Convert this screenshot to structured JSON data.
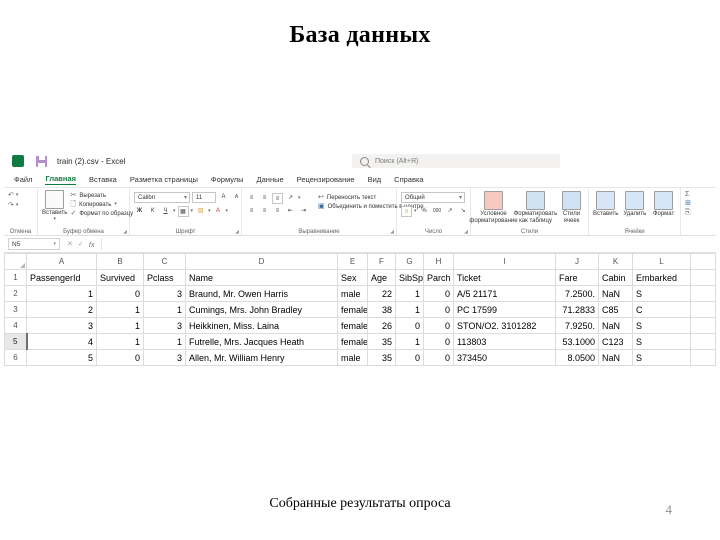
{
  "slide": {
    "title": "База данных",
    "caption": "Собранные результаты опроса",
    "number": "4"
  },
  "excel": {
    "title_bar": {
      "file_title": "train (2).csv  -  Excel",
      "excel_icon": "excel-app-icon",
      "save_icon": "save-icon",
      "search_icon": "search-icon",
      "search_placeholder": "Поиск (Alt+Я)"
    },
    "tabs": [
      {
        "label": "Файл",
        "active": false
      },
      {
        "label": "Главная",
        "active": true
      },
      {
        "label": "Вставка",
        "active": false
      },
      {
        "label": "Разметка страницы",
        "active": false
      },
      {
        "label": "Формулы",
        "active": false
      },
      {
        "label": "Данные",
        "active": false
      },
      {
        "label": "Рецензирование",
        "active": false
      },
      {
        "label": "Вид",
        "active": false
      },
      {
        "label": "Справка",
        "active": false
      }
    ],
    "ribbon": {
      "undo_group": {
        "label": "Отмена",
        "undo_icon": "undo-arrow-icon",
        "redo_icon": "redo-arrow-icon",
        "dropdown_icon": "chevron-down-icon"
      },
      "clipboard_group": {
        "label": "Буфер обмена",
        "paste_label": "Вставить",
        "paste_icon": "clipboard-icon",
        "cut_label": "Вырезать",
        "cut_icon": "scissors-icon",
        "copy_label": "Копировать",
        "copy_icon": "copy-icon",
        "format_painter_label": "Формат по образцу",
        "format_painter_icon": "paintbrush-icon",
        "dialog_icon": "dialog-launcher-icon"
      },
      "font_group": {
        "label": "Шрифт",
        "font_name": "Calibri",
        "font_size": "11",
        "bold_label": "Ж",
        "italic_label": "К",
        "underline_label": "Ч",
        "grow_label": "A",
        "shrink_label": "A",
        "borders_icon": "borders-icon",
        "fill_icon": "fill-color-icon",
        "font_color_icon": "font-color-icon",
        "dialog_icon": "dialog-launcher-icon"
      },
      "alignment_group": {
        "label": "Выравнивание",
        "wrap_text_label": "Переносить текст",
        "wrap_text_icon": "wrap-text-icon",
        "merge_label": "Объединить и поместить в центре",
        "merge_icon": "merge-cells-icon",
        "orientation_icon": "text-orientation-icon",
        "dialog_icon": "dialog-launcher-icon"
      },
      "number_group": {
        "label": "Число",
        "format_value": "Общий",
        "currency_icon": "currency-icon",
        "percent_label": "%",
        "comma_label": "000",
        "increase_decimal_icon": "increase-decimal-icon",
        "decrease_decimal_icon": "decrease-decimal-icon",
        "dialog_icon": "dialog-launcher-icon"
      },
      "styles_group": {
        "label": "Стили",
        "conditional_label": "Условное форматирование",
        "conditional_icon": "conditional-formatting-icon",
        "table_label": "Форматировать как таблицу",
        "table_icon": "format-as-table-icon",
        "cell_styles_label": "Стили ячеек",
        "cell_styles_icon": "cell-styles-icon"
      },
      "cells_group": {
        "label": "Ячейки",
        "insert_label": "Вставить",
        "insert_icon": "insert-cells-icon",
        "delete_label": "Удалить",
        "delete_icon": "delete-cells-icon",
        "format_label": "Формат",
        "format_icon": "format-cells-icon"
      },
      "editing_group": {
        "autosum_icon": "autosum-icon",
        "fill_icon": "fill-down-icon",
        "clear_icon": "clear-icon"
      }
    },
    "formula_bar": {
      "name_box_value": "N5",
      "name_box_dropdown_icon": "chevron-down-icon",
      "cancel_icon": "cancel-icon",
      "enter_icon": "confirm-check-icon",
      "function_icon": "insert-function-icon",
      "formula_value": ""
    },
    "sheet": {
      "column_letters": [
        "A",
        "B",
        "C",
        "D",
        "E",
        "F",
        "G",
        "H",
        "I",
        "J",
        "K",
        "L"
      ],
      "row_numbers": [
        "1",
        "2",
        "3",
        "4",
        "5",
        "6"
      ],
      "selected_row": "5",
      "headers": [
        "PassengerId",
        "Survived",
        "Pclass",
        "Name",
        "Sex",
        "Age",
        "SibSp",
        "Parch",
        "Ticket",
        "Fare",
        "Cabin",
        "Embarked"
      ],
      "rows": [
        [
          "1",
          "0",
          "3",
          "Braund, Mr. Owen Harris",
          "male",
          "22",
          "1",
          "0",
          "A/5 21171",
          "7.2500.",
          "NaN",
          "S"
        ],
        [
          "2",
          "1",
          "1",
          "Cumings, Mrs. John Bradley",
          "female",
          "38",
          "1",
          "0",
          "PC 17599",
          "71.2833",
          "C85",
          "C"
        ],
        [
          "3",
          "1",
          "3",
          "Heikkinen, Miss. Laina",
          "female",
          "26",
          "0",
          "0",
          "STON/O2. 3101282",
          "7.9250.",
          "NaN",
          "S"
        ],
        [
          "4",
          "1",
          "1",
          "Futrelle, Mrs. Jacques Heath",
          "female",
          "35",
          "1",
          "0",
          "113803",
          "53.1000",
          "C123",
          "S"
        ],
        [
          "5",
          "0",
          "3",
          "Allen, Mr. William Henry",
          "male",
          "35",
          "0",
          "0",
          "373450",
          "8.0500",
          "NaN",
          "S"
        ]
      ]
    }
  },
  "colors": {
    "excel_green": "#107c41",
    "header_text": "#555555",
    "grid_line": "#dcdcdc"
  }
}
